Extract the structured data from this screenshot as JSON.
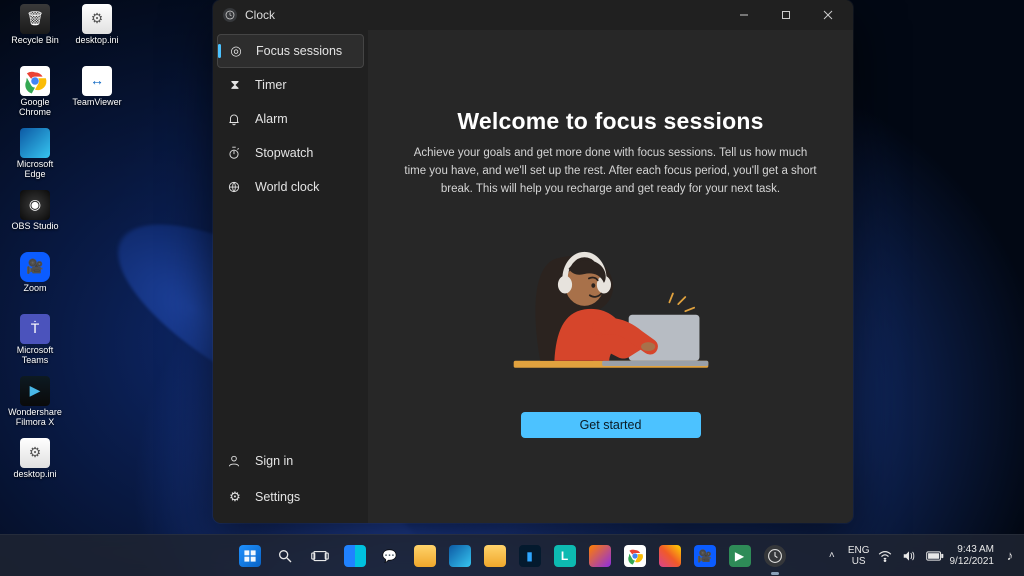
{
  "desktop_icons": [
    {
      "name": "recycle-bin",
      "label": "Recycle Bin"
    },
    {
      "name": "desktop-ini",
      "label": "desktop.ini"
    },
    {
      "name": "google-chrome",
      "label": "Google Chrome"
    },
    {
      "name": "teamviewer",
      "label": "TeamViewer"
    },
    {
      "name": "microsoft-edge",
      "label": "Microsoft Edge"
    },
    {
      "name": "obs-studio",
      "label": "OBS Studio"
    },
    {
      "name": "zoom",
      "label": "Zoom"
    },
    {
      "name": "microsoft-teams",
      "label": "Microsoft Teams"
    },
    {
      "name": "wondershare-filmora",
      "label": "Wondershare Filmora X"
    },
    {
      "name": "desktop-ini-2",
      "label": "desktop.ini"
    }
  ],
  "app": {
    "title": "Clock",
    "window_controls": {
      "minimize": "Minimize",
      "maximize": "Maximize",
      "close": "Close"
    }
  },
  "sidebar": {
    "items": [
      {
        "icon": "target",
        "label": "Focus sessions",
        "selected": true
      },
      {
        "icon": "hourglass",
        "label": "Timer",
        "selected": false
      },
      {
        "icon": "bell",
        "label": "Alarm",
        "selected": false
      },
      {
        "icon": "stopwatch",
        "label": "Stopwatch",
        "selected": false
      },
      {
        "icon": "globe",
        "label": "World clock",
        "selected": false
      }
    ],
    "bottom": [
      {
        "icon": "person",
        "label": "Sign in"
      },
      {
        "icon": "gear",
        "label": "Settings"
      }
    ]
  },
  "main": {
    "title": "Welcome to focus sessions",
    "description": "Achieve your goals and get more done with focus sessions. Tell us how much time you have, and we'll set up the rest. After each focus period, you'll get a short break. This will help you recharge and get ready for your next task.",
    "cta": "Get started"
  },
  "taskbar": {
    "language": {
      "line1": "ENG",
      "line2": "US"
    },
    "time": "9:43 AM",
    "date": "9/12/2021",
    "wifi": "Wi-Fi",
    "volume": "Volume",
    "battery": "Battery",
    "items": [
      "start",
      "search",
      "task-view",
      "widgets",
      "chat",
      "explorer",
      "edge",
      "folder",
      "phone",
      "lightroom",
      "firefox",
      "chrome",
      "pix",
      "cam",
      "green",
      "clock"
    ]
  },
  "colors": {
    "accent": "#4cc2ff"
  }
}
